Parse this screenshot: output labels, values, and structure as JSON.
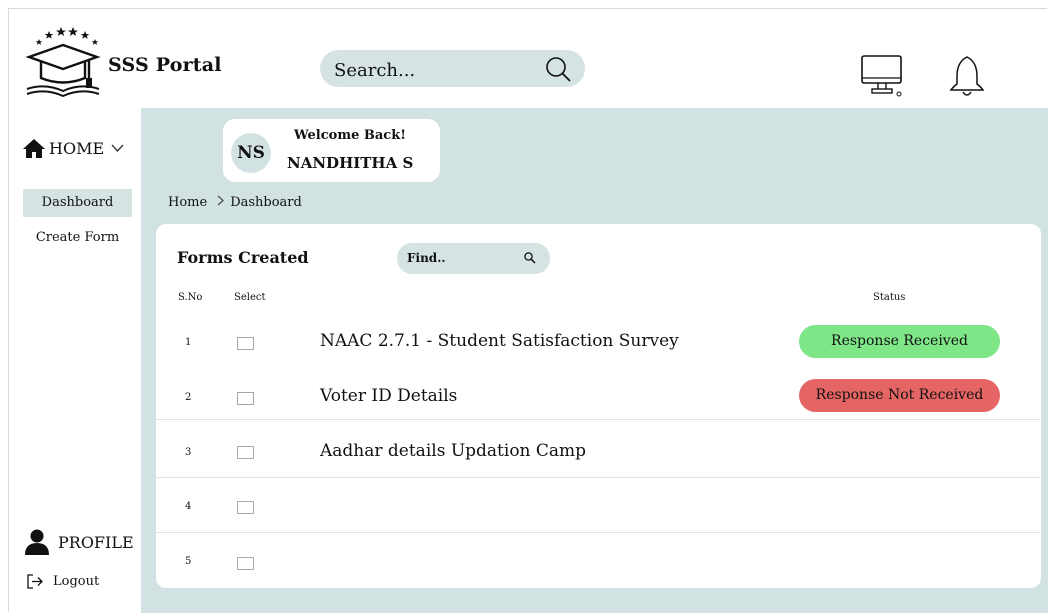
{
  "header": {
    "app_title": "SSS Portal",
    "search_placeholder": "Search..."
  },
  "sidebar": {
    "home_label": "HOME",
    "items": [
      {
        "label": "Dashboard",
        "active": true
      },
      {
        "label": "Create Form",
        "active": false
      }
    ],
    "profile_label": "PROFILE",
    "logout_label": "Logout"
  },
  "welcome": {
    "initials": "NS",
    "greeting": "Welcome Back!",
    "user_name": "NANDHITHA S"
  },
  "breadcrumb": [
    "Home",
    "Dashboard"
  ],
  "forms": {
    "title": "Forms Created",
    "find_placeholder": "Find..",
    "columns": {
      "sno": "S.No",
      "select": "Select",
      "status": "Status"
    },
    "rows": [
      {
        "sno": "1",
        "name": "NAAC 2.7.1 - Student Satisfaction Survey",
        "status": "Response Received",
        "status_type": "ok"
      },
      {
        "sno": "2",
        "name": "Voter ID Details",
        "status": "Response Not Received",
        "status_type": "no"
      },
      {
        "sno": "3",
        "name": "Aadhar details Updation Camp",
        "status": "",
        "status_type": ""
      },
      {
        "sno": "4",
        "name": "",
        "status": "",
        "status_type": ""
      },
      {
        "sno": "5",
        "name": "",
        "status": "",
        "status_type": ""
      }
    ]
  },
  "colors": {
    "accent": "#d5e3e3",
    "main_bg": "#d2e2e2",
    "status_ok": "#7ee687",
    "status_no": "#e56565"
  }
}
